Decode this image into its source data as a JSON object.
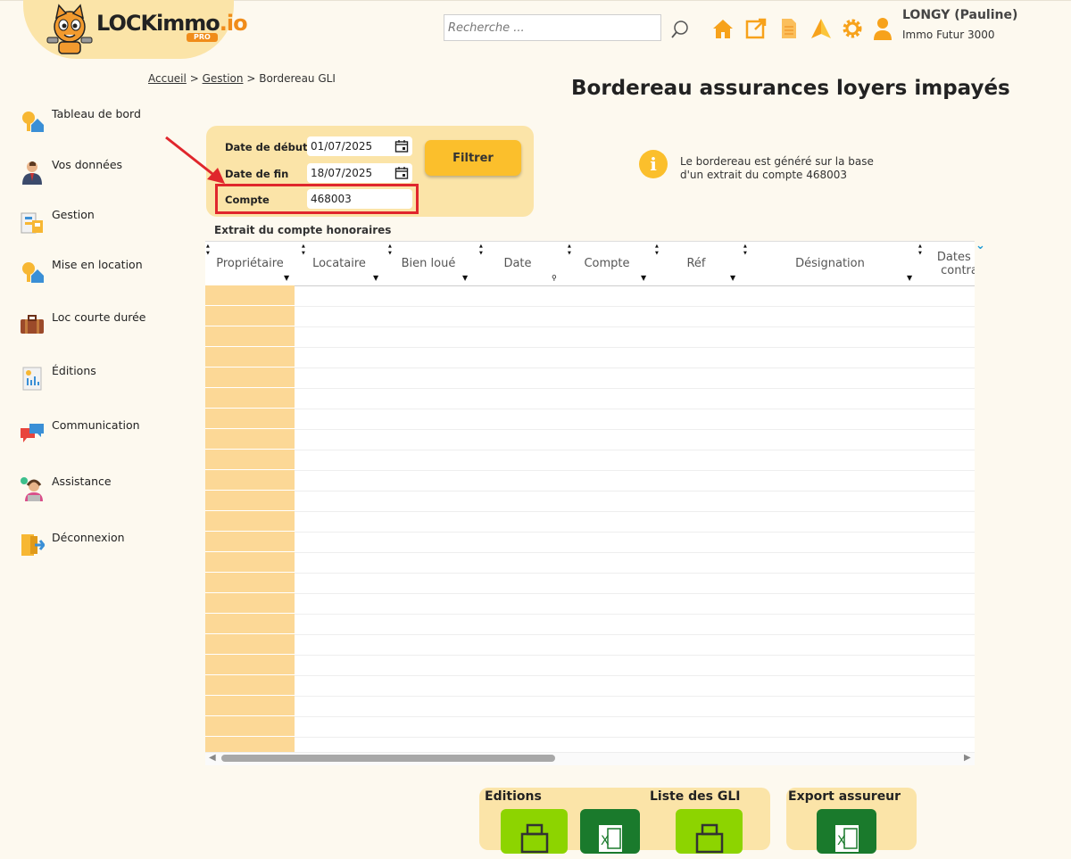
{
  "header": {
    "logo_main": "LOCKimmo",
    "logo_suffix": ".io",
    "logo_badge": "PRO",
    "search_placeholder": "Recherche ...",
    "icons": [
      "home-icon",
      "external-link-icon",
      "document-icon",
      "send-icon",
      "gear-icon",
      "user-icon"
    ],
    "user_name": "LONGY (Pauline)",
    "user_company": "Immo Futur 3000"
  },
  "breadcrumb": {
    "items": [
      "Accueil",
      "Gestion",
      "Bordereau GLI"
    ],
    "separator": ">"
  },
  "page_title": "Bordereau assurances loyers impayés",
  "sidebar": {
    "items": [
      {
        "label": "Tableau de bord",
        "icon": "dashboard-icon"
      },
      {
        "label": "Vos données",
        "icon": "person-icon"
      },
      {
        "label": "Gestion",
        "icon": "management-icon"
      },
      {
        "label": "Mise en location",
        "icon": "rental-icon"
      },
      {
        "label": "Loc courte durée",
        "icon": "suitcase-icon"
      },
      {
        "label": "Éditions",
        "icon": "report-icon"
      },
      {
        "label": "Communication",
        "icon": "chat-icon"
      },
      {
        "label": "Assistance",
        "icon": "support-icon"
      },
      {
        "label": "Déconnexion",
        "icon": "logout-icon"
      }
    ]
  },
  "filters": {
    "start_label": "Date de début",
    "start_value": "01/07/2025",
    "end_label": "Date de fin",
    "end_value": "18/07/2025",
    "account_label": "Compte",
    "account_value": "468003",
    "filter_button": "Filtrer"
  },
  "info": {
    "line1": "Le bordereau est généré sur la base",
    "line2": "d'un extrait du compte 468003"
  },
  "table": {
    "title": "Extrait du compte honoraires",
    "columns": [
      "Propriétaire",
      "Locataire",
      "Bien loué",
      "Date",
      "Compte",
      "Réf",
      "Désignation",
      "Dates de contrat"
    ],
    "column_lines": [
      [
        "Propriétaire"
      ],
      [
        "Locataire"
      ],
      [
        "Bien loué"
      ],
      [
        "Date"
      ],
      [
        "Compte"
      ],
      [
        "Réf"
      ],
      [
        "Désignation"
      ],
      [
        "Dates d",
        "contra"
      ]
    ],
    "row_count": 23
  },
  "bottom": {
    "editions_title": "Editions",
    "gli_title": "Liste des GLI",
    "export_title": "Export assureur"
  },
  "colors": {
    "background": "#fdf9ef",
    "panel": "#fbe4a8",
    "accent": "#fbbf2c",
    "orange": "#f08c1a",
    "highlight_red": "#e0262c",
    "green_light": "#8dd400",
    "green_dark": "#1a7a2c"
  }
}
